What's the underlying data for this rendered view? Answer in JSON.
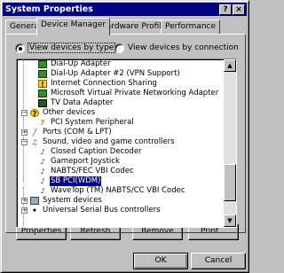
{
  "window": {
    "title": "System Properties",
    "help_label": "?",
    "close_label": "×"
  },
  "tabs": [
    {
      "label": "General"
    },
    {
      "label": "Device Manager"
    },
    {
      "label": "Hardware Profiles"
    },
    {
      "label": "Performance"
    }
  ],
  "view_options": {
    "by_type": "View devices by type",
    "by_connection": "View devices by connection",
    "selected": "by_type"
  },
  "tree": {
    "rows": [
      {
        "label": "Dial-Up Adapter",
        "icon": "network-adapter-icon"
      },
      {
        "label": "Dial-Up Adapter #2 (VPN Support)",
        "icon": "network-adapter-icon"
      },
      {
        "label": "Internet Connection Sharing",
        "icon": "network-adapter-warning-icon"
      },
      {
        "label": "Microsoft Virtual Private Networking Adapter",
        "icon": "network-adapter-icon"
      },
      {
        "label": "TV Data Adapter",
        "icon": "network-adapter-icon"
      },
      {
        "label": "Other devices",
        "icon": "question-mark-icon",
        "expander": "−"
      },
      {
        "label": "PCI System Peripheral",
        "icon": "question-mark-icon"
      },
      {
        "label": "Ports (COM & LPT)",
        "icon": "port-icon",
        "expander": "+"
      },
      {
        "label": "Sound, video and game controllers",
        "icon": "sound-icon",
        "expander": "−"
      },
      {
        "label": "Closed Caption Decoder",
        "icon": "sound-device-icon"
      },
      {
        "label": "Gameport Joystick",
        "icon": "sound-device-icon"
      },
      {
        "label": "NABTS/FEC VBI Codec",
        "icon": "sound-device-icon"
      },
      {
        "label": "SB PCI(WDM)",
        "icon": "sound-device-icon",
        "selected": true
      },
      {
        "label": "WaveTop (TM) NABTS/CC VBI Codec",
        "icon": "sound-device-icon"
      },
      {
        "label": "System devices",
        "icon": "computer-icon",
        "expander": "+"
      },
      {
        "label": "Universal Serial Bus controllers",
        "icon": "usb-icon",
        "expander": "+"
      }
    ]
  },
  "buttons": {
    "properties": "Properties",
    "refresh": "Refresh",
    "remove": "Remove",
    "print": "Print...",
    "ok": "OK",
    "cancel": "Cancel"
  }
}
